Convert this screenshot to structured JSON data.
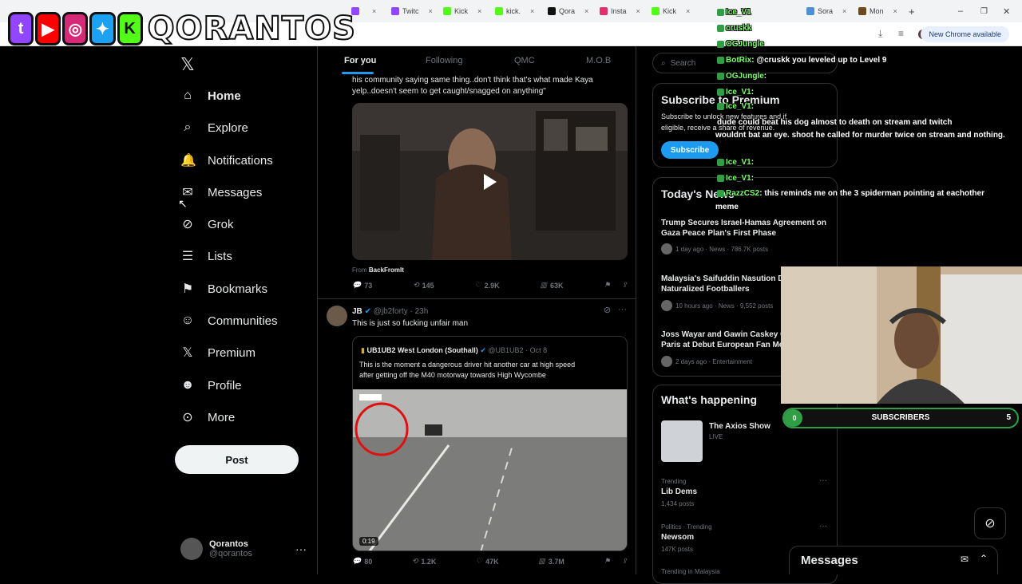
{
  "browser": {
    "tabs": [
      {
        "label": "",
        "color": "#9146ff"
      },
      {
        "label": "Twitc",
        "color": "#9146ff"
      },
      {
        "label": "Kick",
        "color": "#53fc18"
      },
      {
        "label": "kick.",
        "color": "#53fc18"
      },
      {
        "label": "Qora",
        "color": "#111111"
      },
      {
        "label": "Insta",
        "color": "#e1306c"
      },
      {
        "label": "Kick",
        "color": "#53fc18"
      },
      {
        "label": "Sora",
        "color": "#4a90d9"
      },
      {
        "label": "Mon",
        "color": "#6b4a1d"
      }
    ],
    "profile_pill": "New Chrome available"
  },
  "banner": {
    "name": "QORANTOS",
    "icons": [
      "twitch-icon",
      "youtube-icon",
      "instagram-icon",
      "twitter-icon",
      "kick-icon"
    ]
  },
  "nav": {
    "items": [
      {
        "label": "Home",
        "icon": "⌂"
      },
      {
        "label": "Explore",
        "icon": "⌕"
      },
      {
        "label": "Notifications",
        "icon": "🔔"
      },
      {
        "label": "Messages",
        "icon": "✉"
      },
      {
        "label": "Grok",
        "icon": "⊘"
      },
      {
        "label": "Lists",
        "icon": "☰"
      },
      {
        "label": "Bookmarks",
        "icon": "⚑"
      },
      {
        "label": "Communities",
        "icon": "☺"
      },
      {
        "label": "Premium",
        "icon": "𝕏"
      },
      {
        "label": "Profile",
        "icon": "☻"
      },
      {
        "label": "More",
        "icon": "⊙"
      }
    ],
    "post_label": "Post",
    "user": {
      "name": "Qorantos",
      "handle": "@qorantos"
    }
  },
  "feed": {
    "tabs": [
      "For you",
      "Following",
      "QMC",
      "M.O.B"
    ],
    "tweet1": {
      "text_line1": "his community saying same thing..don't think that's what made Kaya",
      "text_line2": "yelp..doesn't seem to get caught/snagged on anything\"",
      "from_label": "From",
      "from_source": "BackFromIt",
      "replies": "73",
      "reposts": "145",
      "likes": "2.9K",
      "views": "63K"
    },
    "tweet2": {
      "author": "JB",
      "handle": "@jb2forty",
      "time": "23h",
      "text": "This is just so fucking unfair man",
      "quote_author": "UB1UB2 West London (Southall)",
      "quote_handle": "@UB1UB2",
      "quote_date": "Oct 8",
      "quote_line1": "This is the moment a dangerous driver hit another car at high speed",
      "quote_line2": "after getting off the M40 motorway towards High Wycombe",
      "video_duration": "0:19",
      "replies": "80",
      "reposts": "1.2K",
      "likes": "47K",
      "views": "3.7M"
    }
  },
  "sidebar": {
    "search_placeholder": "Search",
    "premium": {
      "title": "Subscribe to Premium",
      "line1": "Subscribe to unlock new features and if",
      "line2": "eligible, receive a share of revenue.",
      "button": "Subscribe"
    },
    "news": {
      "title": "Today's News",
      "items": [
        {
          "title": "Trump Secures Israel-Hamas Agreement on Gaza Peace Plan's First Phase",
          "meta": "1 day ago · News · 786.7K posts"
        },
        {
          "title": "Malaysia's Saifuddin Nasution Defends Naturalized Footballers",
          "meta": "10 hours ago · News · 9,552 posts"
        },
        {
          "title": "Joss Wayar and Gawin Caskey Capture Paris at Debut European Fan Meet",
          "meta": "2 days ago · Entertainment"
        }
      ]
    },
    "happening": {
      "title": "What's happening",
      "live_title": "The Axios Show",
      "live_badge": "LIVE",
      "trends": [
        {
          "label": "Trending",
          "name": "Lib Dems",
          "posts": "1,434 posts"
        },
        {
          "label": "Politics · Trending",
          "name": "Newsom",
          "posts": "147K posts"
        },
        {
          "label": "Trending in Malaysia",
          "name": "",
          "posts": ""
        }
      ]
    }
  },
  "chat": {
    "lines": [
      {
        "user": "Ice_V1",
        "msg": ""
      },
      {
        "user": "cruskk",
        "msg": ""
      },
      {
        "user": "OGJungle",
        "msg": ""
      },
      {
        "user": "BotRix",
        "msg": ": @cruskk you leveled up to Level 9"
      },
      {
        "user": "OGJungle",
        "msg": ":"
      },
      {
        "user": "Ice_V1",
        "msg": ":"
      },
      {
        "user": "Ice_V1",
        "msg": ":"
      },
      {
        "user": "",
        "msg": "dude could beat his dog almost to death on stream and twitch"
      },
      {
        "user": "",
        "msg": "wouldnt bat an eye. shoot he called for murder twice on stream and nothing."
      },
      {
        "user": "Ice_V1",
        "msg": ":"
      },
      {
        "user": "Ice_V1",
        "msg": ":"
      },
      {
        "user": "RazzCS2",
        "msg": ": this reminds me on the 3 spiderman pointing at eachother"
      },
      {
        "user": "",
        "msg": "meme"
      }
    ]
  },
  "subscribers": {
    "label": "SUBSCRIBERS",
    "current": "0",
    "goal": "5",
    "progress": 0.02
  },
  "messages_drawer": {
    "title": "Messages"
  },
  "colors": {
    "accent": "#1d9bf0",
    "bg": "#000000",
    "chat_user": "#7cff6b",
    "sub_bar": "#2f9e44"
  }
}
